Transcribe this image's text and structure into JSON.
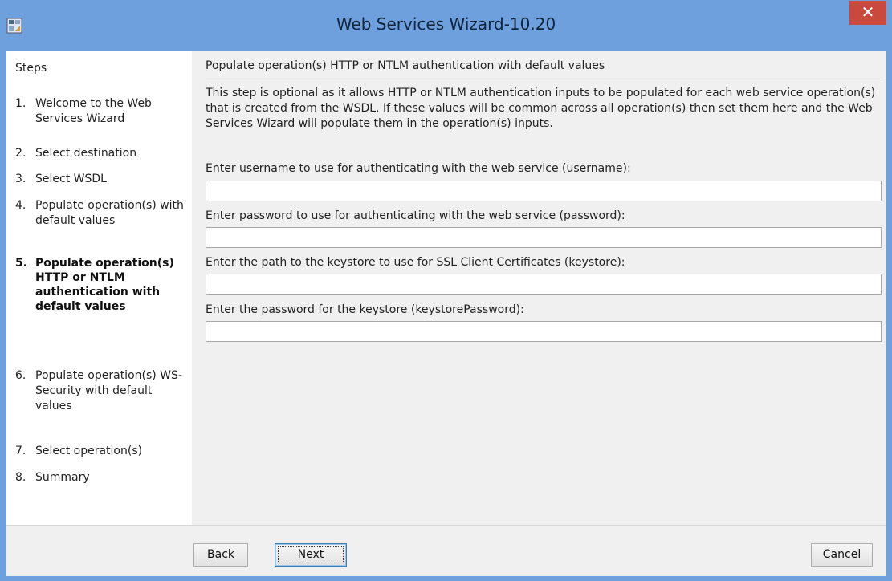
{
  "window": {
    "title": "Web Services Wizard-10.20",
    "close_glyph": "✕",
    "app_icon": "wizard-app-icon",
    "accent_color": "#6ea0dd",
    "close_color": "#c94a3c"
  },
  "sidebar": {
    "title": "Steps",
    "steps": [
      {
        "num": "1.",
        "label": "Welcome to the Web Services Wizard",
        "active": false
      },
      {
        "num": "2.",
        "label": "Select destination",
        "active": false
      },
      {
        "num": "3.",
        "label": "Select WSDL",
        "active": false
      },
      {
        "num": "4.",
        "label": "Populate operation(s) with default values",
        "active": false
      },
      {
        "num": "5.",
        "label": "Populate operation(s) HTTP or NTLM authentication with default values",
        "active": true
      },
      {
        "num": "6.",
        "label": "Populate operation(s) WS-Security with default values",
        "active": false
      },
      {
        "num": "7.",
        "label": "Select operation(s)",
        "active": false
      },
      {
        "num": "8.",
        "label": "Summary",
        "active": false
      }
    ]
  },
  "main": {
    "section_title": "Populate operation(s) HTTP or NTLM authentication with default values",
    "description": "This step is optional as it allows HTTP or NTLM authentication inputs  to be populated for each web service operation(s) that is created from the WSDL. If these values will be common across all operation(s) then set them here and the Web Services Wizard will populate them in the operation(s) inputs.",
    "fields": [
      {
        "label": "Enter username to use for authenticating with the web service (username):",
        "value": "",
        "placeholder": ""
      },
      {
        "label": "Enter password to use for authenticating with the web service (password):",
        "value": "",
        "placeholder": ""
      },
      {
        "label": "Enter the path to the keystore to use for SSL Client Certificates (keystore):",
        "value": "",
        "placeholder": ""
      },
      {
        "label": "Enter the password for the keystore (keystorePassword):",
        "value": "",
        "placeholder": ""
      }
    ]
  },
  "footer": {
    "back_mnemonic": "B",
    "back_rest": "ack",
    "next_mnemonic": "N",
    "next_rest": "ext",
    "cancel_label": "Cancel"
  }
}
